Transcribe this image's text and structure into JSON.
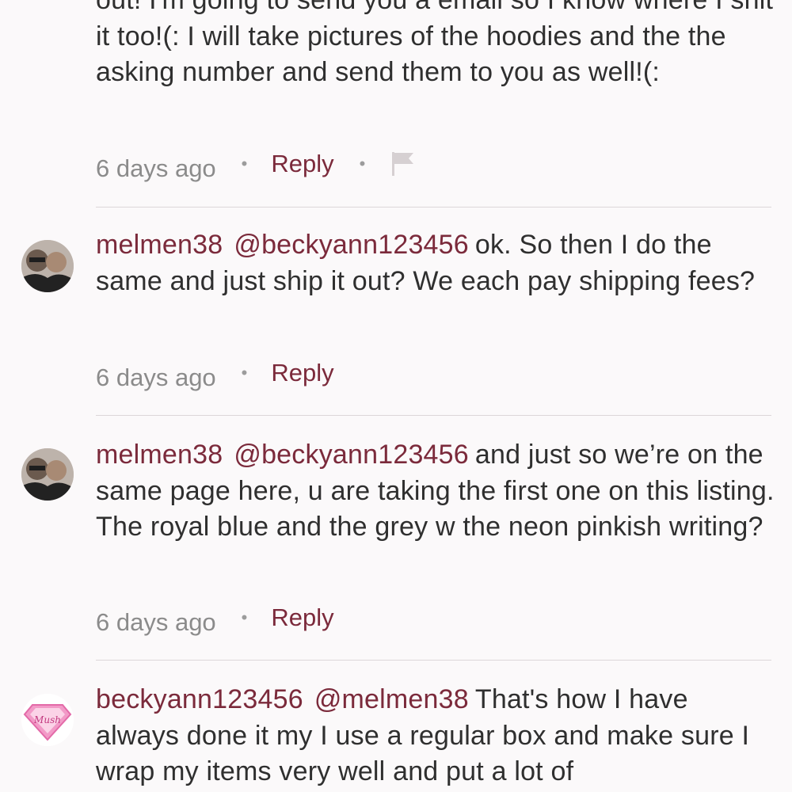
{
  "comments": [
    {
      "text": "out! I'm going to send you a email so I know where  I shit it too!(: I will take pictures of the hoodies and the the asking number and send them to you as well!(:",
      "time": "6 days ago",
      "reply_label": "Reply"
    },
    {
      "username": "melmen38",
      "mention": "@beckyann123456",
      "text": "ok. So then I do the same and just ship it out? We each pay shipping fees?",
      "time": "6 days ago",
      "reply_label": "Reply"
    },
    {
      "username": "melmen38",
      "mention": "@beckyann123456",
      "text": "and just so we’re on the same page here, u are taking the first one on this listing. The royal blue and the grey w the neon pinkish writing?",
      "time": "6 days ago",
      "reply_label": "Reply"
    },
    {
      "username": "beckyann123456",
      "mention": "@melmen38",
      "text": "That's how I have always done it my I use a regular box and make sure I wrap my items very well and put a lot of"
    }
  ],
  "colors": {
    "accent": "#7b2a3b",
    "meta_gray": "#8b8b8b",
    "divider": "#dcd7d9",
    "background": "#fbf9fa"
  },
  "icons": {
    "flag": "flag-icon",
    "avatar_badge": "superman-shield-icon"
  }
}
